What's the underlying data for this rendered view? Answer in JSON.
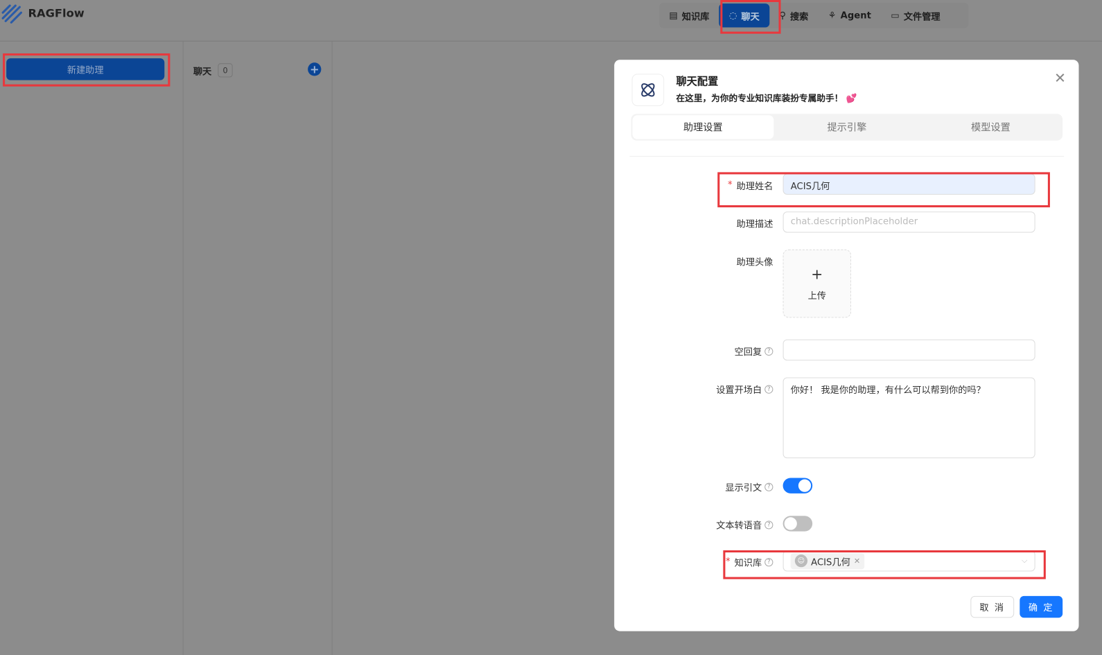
{
  "app": {
    "brand": "RAGFlow"
  },
  "nav": [
    {
      "label": "知识库",
      "icon": "database-icon"
    },
    {
      "label": "聊天",
      "icon": "chat-icon",
      "active": true
    },
    {
      "label": "搜索",
      "icon": "search-icon"
    },
    {
      "label": "Agent",
      "icon": "agent-icon"
    },
    {
      "label": "文件管理",
      "icon": "folder-icon"
    }
  ],
  "sidebar": {
    "new_button": "新建助理",
    "chat_label": "聊天",
    "chat_count": "0"
  },
  "modal": {
    "title": "聊天配置",
    "subtitle": "在这里，为你的专业知识库装扮专属助手！",
    "tabs": [
      "助理设置",
      "提示引擎",
      "模型设置"
    ],
    "fields": {
      "name_label": "助理姓名",
      "name_value": "ACIS几何",
      "desc_label": "助理描述",
      "desc_placeholder": "chat.descriptionPlaceholder",
      "avatar_label": "助理头像",
      "upload": "上传",
      "empty_label": "空回复",
      "opener_label": "设置开场白",
      "opener_value": "你好！ 我是你的助理，有什么可以帮到你的吗？",
      "quote_label": "显示引文",
      "quote_on": true,
      "tts_label": "文本转语音",
      "tts_on": false,
      "kb_label": "知识库",
      "kb_tag": "ACIS几何"
    },
    "cancel": "取 消",
    "ok": "确 定"
  },
  "colors": {
    "primary": "#1677ff",
    "highlight": "#e8383d"
  }
}
